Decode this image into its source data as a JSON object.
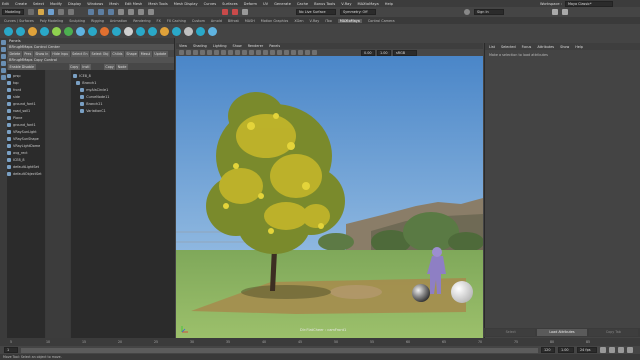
{
  "menubar": {
    "items": [
      "Edit",
      "Create",
      "Select",
      "Modify",
      "Display",
      "Windows",
      "Mesh",
      "Edit Mesh",
      "Mesh Tools",
      "Mesh Display",
      "Curves",
      "Surfaces",
      "Deform",
      "UV",
      "Generate",
      "Cache",
      "Bonus Tools",
      "V-Ray",
      "MAXtoMaya",
      "Help"
    ],
    "workspace_label": "Workspace :",
    "workspace_value": "Maya Classic*"
  },
  "statusline": {
    "mode": "Modeling",
    "live_surface": "No Live Surface",
    "symmetry": "Symmetry: Off",
    "sign_in": "Sign In"
  },
  "shelf_tabs": [
    "Curves / Surfaces",
    "Poly Modeling",
    "Sculpting",
    "Rigging",
    "Animation",
    "Rendering",
    "FX",
    "FX Caching",
    "Custom",
    "Arnold",
    "Bifrost",
    "MASH",
    "Motion Graphics",
    "XGen",
    "V-Ray",
    "iToo",
    "MAXtoMaya",
    "Control Camera"
  ],
  "shelf_active": "MAXtoMaya",
  "shelf_icon_colors": [
    "#2aa8c8",
    "#2aa8c8",
    "#e0a23a",
    "#2aa8c8",
    "#8fd14f",
    "#4caf50",
    "#5fb3e0",
    "#2aa8c8",
    "#e07030",
    "#2aa8c8",
    "#d0d0d0",
    "#2aa8c8",
    "#2aa8c8",
    "#e0a23a",
    "#2aa8c8",
    "#c0c0c0",
    "#2aa8c8",
    "#5fb3e0"
  ],
  "panels": {
    "title": "Panels",
    "control_center": {
      "header": "BRrugMMaps Control Center",
      "buttons": [
        "Delete",
        "Pres",
        "Show In",
        "Hide Inpu",
        "Select En",
        "Select Obj",
        "Childs",
        "Shape",
        "Mesul",
        "Update"
      ]
    },
    "copy_control": {
      "header": "BRrugMMaps Copy Control",
      "buttons": [
        "Enable Disable",
        "Copy",
        "Instl",
        "Copy",
        "Node"
      ]
    },
    "left_outliner": [
      "prsp",
      "top",
      "front",
      "side",
      "ground_font1",
      "road_soil1",
      "Plane",
      "ground_font1",
      "VRaySunLight",
      "VRaySunShape",
      "VRayLightDome",
      "avg_rect",
      "ICE8_8",
      "defaultLightSet",
      "defaultObjectSet"
    ],
    "right_outliner": [
      "ICE8_8",
      "Branch1",
      "myAlsCircle1",
      "CurveNode11",
      "Branch21",
      "VariationC1"
    ]
  },
  "viewport": {
    "menu": [
      "View",
      "Shading",
      "Lighting",
      "Show",
      "Renderer",
      "Panels"
    ],
    "camera_label": "Dir:FlatCheer : camFront1",
    "numbers": [
      "0.00",
      "1.00"
    ],
    "gamma": "sRGB gamma"
  },
  "attribute_editor": {
    "menu": [
      "List",
      "Selected",
      "Focus",
      "Attributes",
      "Show",
      "Help"
    ],
    "message": "Make a selection to load attributes",
    "buttons": [
      "Select",
      "Load Attributes",
      "Copy Tab"
    ],
    "active_button": "Load Attributes"
  },
  "timeline": {
    "ticks": [
      "5",
      "10",
      "15",
      "20",
      "25",
      "30",
      "35",
      "40",
      "45",
      "50",
      "55",
      "60",
      "65",
      "70",
      "75",
      "80",
      "85"
    ],
    "start": "1",
    "end": "120",
    "current": "1.00",
    "fps": "24 fps"
  },
  "help_line": "Move Tool: Select an object to move."
}
